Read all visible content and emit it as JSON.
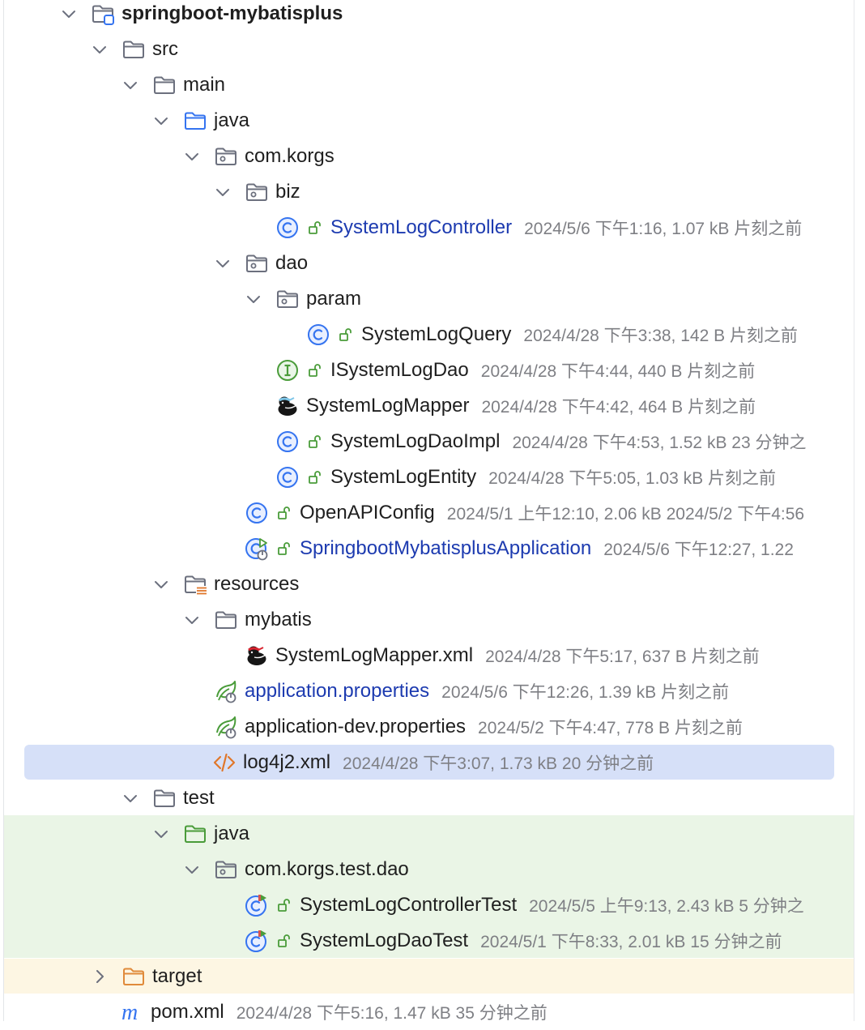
{
  "project": {
    "name": "springboot-mybatisplus"
  },
  "colors": {
    "selection": "#d6e0f8",
    "test_bg": "#eaf5e6",
    "excluded_bg": "#fdf6e3",
    "link": "#1d3bb0",
    "meta": "#7e7f84"
  },
  "tree": {
    "src": "src",
    "main": "main",
    "main_java": "java",
    "pkg_main": "com.korgs",
    "biz": "biz",
    "system_log_controller": {
      "name": "SystemLogController",
      "meta": "2024/5/6 下午1:16, 1.07 kB 片刻之前"
    },
    "dao": "dao",
    "param": "param",
    "system_log_query": {
      "name": "SystemLogQuery",
      "meta": "2024/4/28 下午3:38, 142 B 片刻之前"
    },
    "isystem_log_dao": {
      "name": "ISystemLogDao",
      "meta": "2024/4/28 下午4:44, 440 B 片刻之前"
    },
    "system_log_mapper": {
      "name": "SystemLogMapper",
      "meta": "2024/4/28 下午4:42, 464 B 片刻之前"
    },
    "system_log_dao_impl": {
      "name": "SystemLogDaoImpl",
      "meta": "2024/4/28 下午4:53, 1.52 kB 23 分钟之"
    },
    "system_log_entity": {
      "name": "SystemLogEntity",
      "meta": "2024/4/28 下午5:05, 1.03 kB 片刻之前"
    },
    "open_api_config": {
      "name": "OpenAPIConfig",
      "meta": "2024/5/1 上午12:10, 2.06 kB 2024/5/2 下午4:56"
    },
    "application_class": {
      "name": "SpringbootMybatisplusApplication",
      "meta": "2024/5/6 下午12:27, 1.22"
    },
    "resources": "resources",
    "mybatis": "mybatis",
    "system_log_mapper_xml": {
      "name": "SystemLogMapper.xml",
      "meta": "2024/4/28 下午5:17, 637 B 片刻之前"
    },
    "application_properties": {
      "name": "application.properties",
      "meta": "2024/5/6 下午12:26, 1.39 kB 片刻之前"
    },
    "application_dev_properties": {
      "name": "application-dev.properties",
      "meta": "2024/5/2 下午4:47, 778 B 片刻之前"
    },
    "log4j2_xml": {
      "name": "log4j2.xml",
      "meta": "2024/4/28 下午3:07, 1.73 kB 20 分钟之前"
    },
    "test": "test",
    "test_java": "java",
    "pkg_test": "com.korgs.test.dao",
    "controller_test": {
      "name": "SystemLogControllerTest",
      "meta": "2024/5/5 上午9:13, 2.43 kB 5 分钟之"
    },
    "dao_test": {
      "name": "SystemLogDaoTest",
      "meta": "2024/5/1 下午8:33, 2.01 kB 15 分钟之前"
    },
    "target": "target",
    "pom_xml": {
      "name": "pom.xml",
      "meta": "2024/4/28 下午5:16, 1.47 kB 35 分钟之前"
    }
  }
}
